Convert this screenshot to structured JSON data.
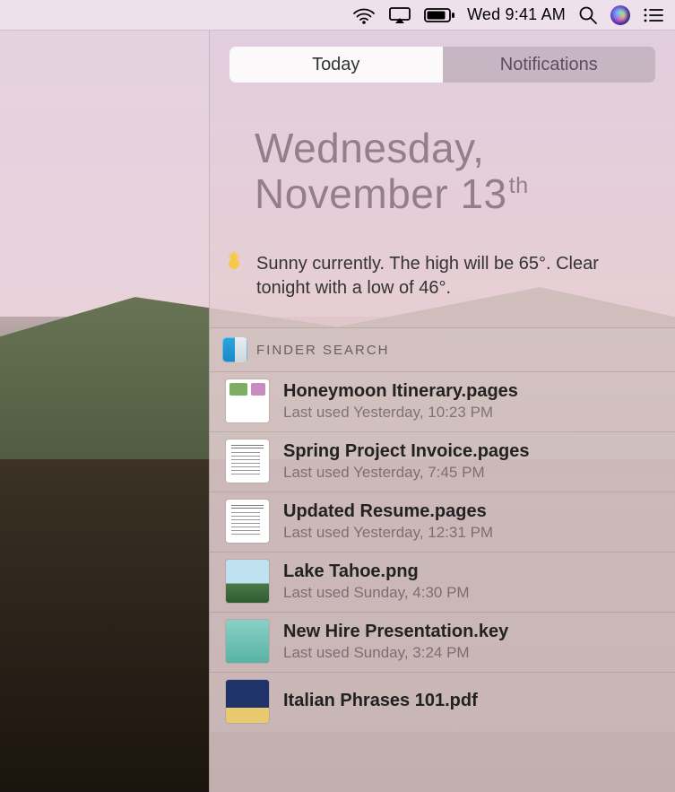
{
  "menubar": {
    "clock": "Wed 9:41 AM"
  },
  "nc": {
    "tabs": {
      "today": "Today",
      "notifications": "Notifications",
      "active": "today"
    },
    "date": {
      "line1": "Wednesday,",
      "line2_prefix": "November 13",
      "line2_suffix": "th"
    },
    "weather": {
      "text": "Sunny currently. The high will be 65°.  Clear tonight with a low of 46°."
    },
    "finder": {
      "title": "FINDER SEARCH",
      "items": [
        {
          "name": "Honeymoon Itinerary.pages",
          "sub": "Last used Yesterday, 10:23 PM",
          "thumb": "itin"
        },
        {
          "name": "Spring Project Invoice.pages",
          "sub": "Last used Yesterday, 7:45 PM",
          "thumb": "doc"
        },
        {
          "name": "Updated Resume.pages",
          "sub": "Last used Yesterday, 12:31 PM",
          "thumb": "doc"
        },
        {
          "name": "Lake Tahoe.png",
          "sub": "Last used Sunday, 4:30 PM",
          "thumb": "png"
        },
        {
          "name": "New Hire Presentation.key",
          "sub": "Last used Sunday, 3:24 PM",
          "thumb": "key"
        },
        {
          "name": "Italian Phrases 101.pdf",
          "sub": "",
          "thumb": "pdf"
        }
      ]
    }
  }
}
